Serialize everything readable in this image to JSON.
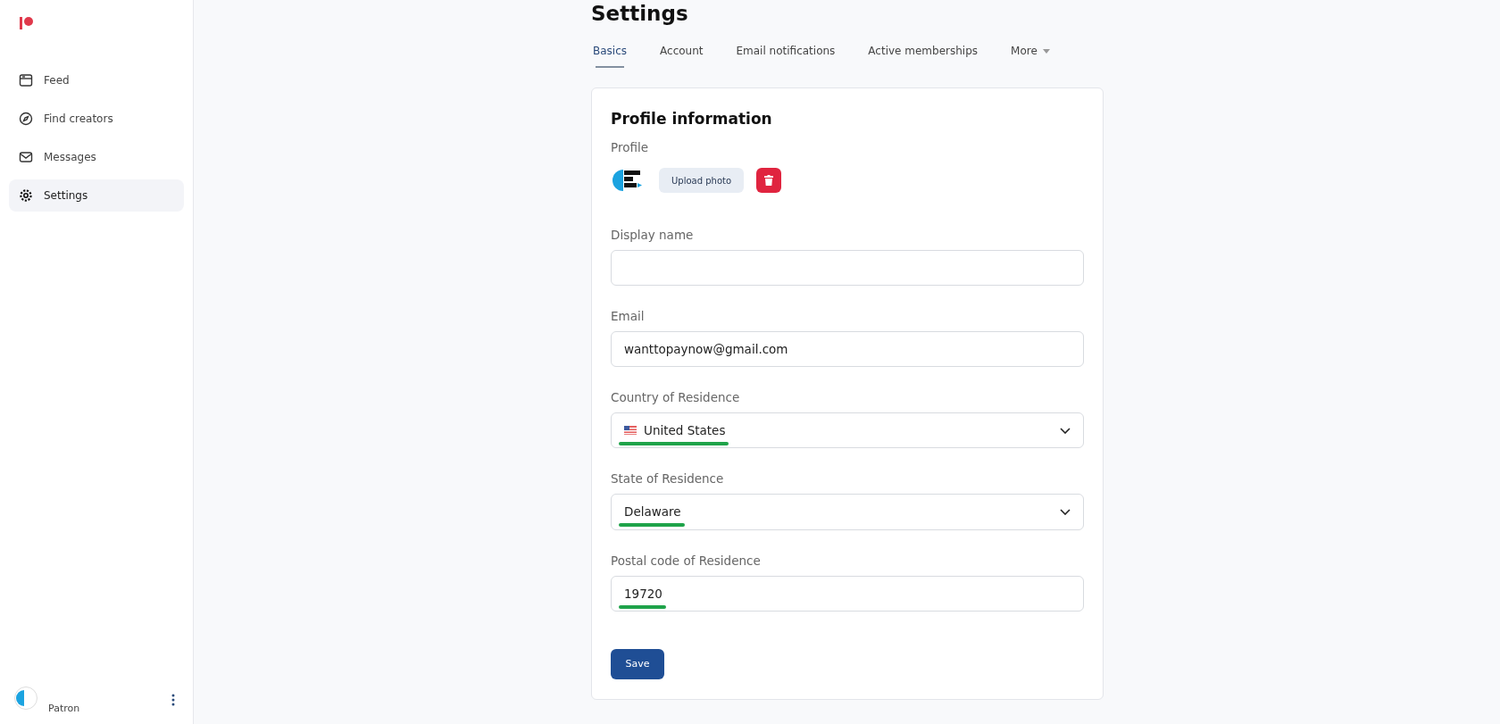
{
  "sidebar": {
    "items": [
      {
        "label": "Feed",
        "kind": "feed",
        "selected": false
      },
      {
        "label": "Find creators",
        "kind": "explore",
        "selected": false
      },
      {
        "label": "Messages",
        "kind": "messages",
        "selected": false
      },
      {
        "label": "Settings",
        "kind": "settings",
        "selected": true
      }
    ],
    "user": {
      "role": "Patron"
    }
  },
  "page": {
    "title": "Settings"
  },
  "tabs": [
    {
      "label": "Basics",
      "selected": true,
      "dropdown": false
    },
    {
      "label": "Account",
      "selected": false,
      "dropdown": false
    },
    {
      "label": "Email notifications",
      "selected": false,
      "dropdown": false
    },
    {
      "label": "Active memberships",
      "selected": false,
      "dropdown": false
    },
    {
      "label": "More",
      "selected": false,
      "dropdown": true
    }
  ],
  "card": {
    "title": "Profile information",
    "profile_label": "Profile",
    "upload_button": "Upload photo",
    "fields": [
      {
        "label": "Display name",
        "kind": "text",
        "highlighted": false
      },
      {
        "label": "Email",
        "kind": "text",
        "value": "wanttopaynow@gmail.com",
        "highlighted": false
      },
      {
        "label": "Country of Residence",
        "kind": "flag-select",
        "value": "United States",
        "highlighted": true
      },
      {
        "label": "State of Residence",
        "kind": "select",
        "value": "Delaware",
        "highlighted": true
      },
      {
        "label": "Postal code of Residence",
        "kind": "text",
        "value": "19720",
        "highlighted": true
      }
    ],
    "save_button": "Save"
  }
}
